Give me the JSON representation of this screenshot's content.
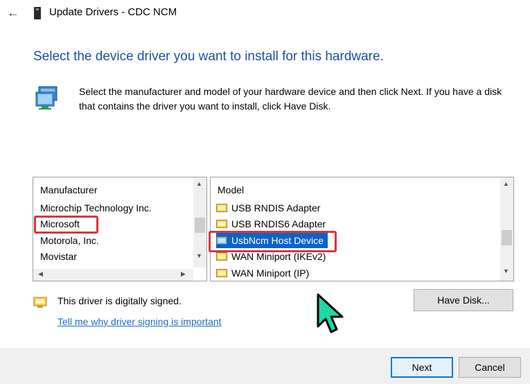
{
  "window": {
    "title": "Update Drivers - CDC NCM"
  },
  "heading": "Select the device driver you want to install for this hardware.",
  "description": "Select the manufacturer and model of your hardware device and then click Next. If you have a disk that contains the driver you want to install, click Have Disk.",
  "manufacturer_list": {
    "header": "Manufacturer",
    "items": [
      "Microchip Technology Inc.",
      "Microsoft",
      "Motorola, Inc.",
      "Movistar"
    ],
    "selected": "Microsoft"
  },
  "model_list": {
    "header": "Model",
    "items": [
      "USB RNDIS Adapter",
      "USB RNDIS6 Adapter",
      "UsbNcm Host Device",
      "WAN Miniport (IKEv2)",
      "WAN Miniport (IP)"
    ],
    "selected": "UsbNcm Host Device"
  },
  "signing": {
    "status": "This driver is digitally signed.",
    "link": "Tell me why driver signing is important"
  },
  "buttons": {
    "have_disk": "Have Disk...",
    "next": "Next",
    "cancel": "Cancel"
  },
  "icons": {
    "back": "back-arrow-icon",
    "device": "device-icon",
    "hardware": "network-adapter-icon",
    "driver": "driver-package-icon",
    "cursor": "mouse-pointer-icon"
  },
  "colors": {
    "heading": "#1f4fa3",
    "selection": "#0a64c8",
    "highlight": "#d9373a",
    "link": "#1a6fd1",
    "cursor": "#1fd8a6"
  }
}
